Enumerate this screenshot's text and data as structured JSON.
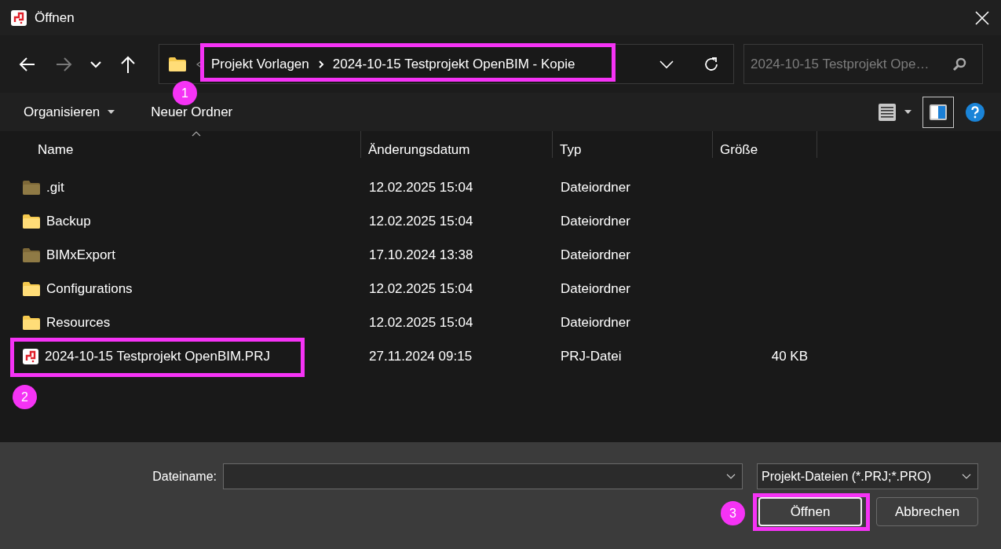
{
  "window": {
    "title": "Öffnen"
  },
  "navigation": {
    "back_disabled": false,
    "forward_disabled": true,
    "breadcrumb": [
      "Projekt Vorlagen",
      "2024-10-15 Testprojekt OpenBIM - Kopie"
    ],
    "step_marker": "1",
    "search": {
      "placeholder": "2024-10-15 Testprojekt Ope…"
    }
  },
  "toolbar": {
    "items": [
      {
        "label": "Organisieren",
        "kind": "menu"
      },
      {
        "label": "Neuer Ordner",
        "kind": "button"
      }
    ],
    "preview_pane_on": true
  },
  "file_list": {
    "columns": [
      {
        "label": "Name",
        "sorted": true
      },
      {
        "label": "Änderungsdatum",
        "sorted": false
      },
      {
        "label": "Typ",
        "sorted": false
      },
      {
        "label": "Größe",
        "sorted": false
      }
    ],
    "rows": [
      {
        "name": ".git",
        "kind": "folder",
        "hidden": true,
        "modified": "12.02.2025 15:04",
        "type": "Dateiordner"
      },
      {
        "name": "Backup",
        "kind": "folder",
        "hidden": false,
        "modified": "12.02.2025 15:04",
        "type": "Dateiordner"
      },
      {
        "name": "BIMxExport",
        "kind": "folder",
        "hidden": true,
        "modified": "17.10.2024 13:38",
        "type": "Dateiordner"
      },
      {
        "name": "Configurations",
        "kind": "folder",
        "hidden": false,
        "modified": "12.02.2025 15:04",
        "type": "Dateiordner"
      },
      {
        "name": "Resources",
        "kind": "folder",
        "hidden": false,
        "modified": "12.02.2025 15:04",
        "type": "Dateiordner"
      },
      {
        "name": "2024-10-15 Testprojekt OpenBIM.PRJ",
        "kind": "file",
        "modified": "27.11.2024 09:15",
        "type": "PRJ-Datei",
        "size": "40 KB",
        "step_marker": "2"
      }
    ]
  },
  "footer": {
    "filename_label": "Dateiname:",
    "file_type": "Projekt-Dateien (*.PRJ;*.PRO)",
    "buttons": [
      {
        "label": "Öffnen",
        "kind": "primary",
        "step_marker": "3"
      },
      {
        "label": "Abbrechen",
        "kind": "secondary"
      }
    ]
  }
}
